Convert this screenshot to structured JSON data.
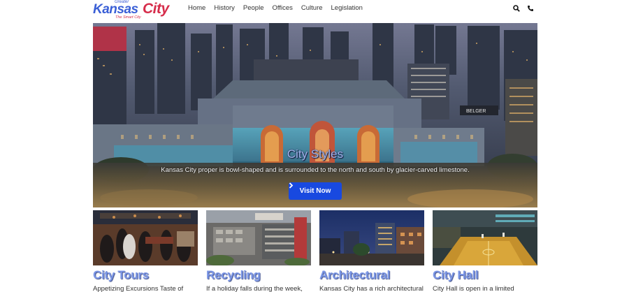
{
  "logo": {
    "greater": "Greater",
    "kansas": "Kansas",
    "city": "City",
    "tagline": "The Smart City"
  },
  "nav": [
    {
      "label": "Home"
    },
    {
      "label": "History"
    },
    {
      "label": "People"
    },
    {
      "label": "Offices"
    },
    {
      "label": "Culture"
    },
    {
      "label": "Legislation"
    }
  ],
  "icons": {
    "search": "search-icon",
    "phone": "phone-icon",
    "chevron": "chevron-right-icon"
  },
  "hero": {
    "title": "City Styles",
    "subtitle": "Kansas City proper is bowl-shaped and is surrounded to the north and south by glacier-carved limestone.",
    "button_label": "Visit Now",
    "signage": "BELGER"
  },
  "cards": [
    {
      "title": "City Tours",
      "desc": "Appetizing Excursions Taste of"
    },
    {
      "title": "Recycling",
      "desc": "If a holiday falls during the week,"
    },
    {
      "title": "Architectural",
      "desc": "Kansas City has a rich architectural"
    },
    {
      "title": "City Hall",
      "desc": "City Hall is open in a limited"
    }
  ],
  "colors": {
    "accent": "#1849e0",
    "logo_blue": "#3a5fd6",
    "logo_red": "#d62d4b",
    "card_title": "#7b96e6"
  }
}
